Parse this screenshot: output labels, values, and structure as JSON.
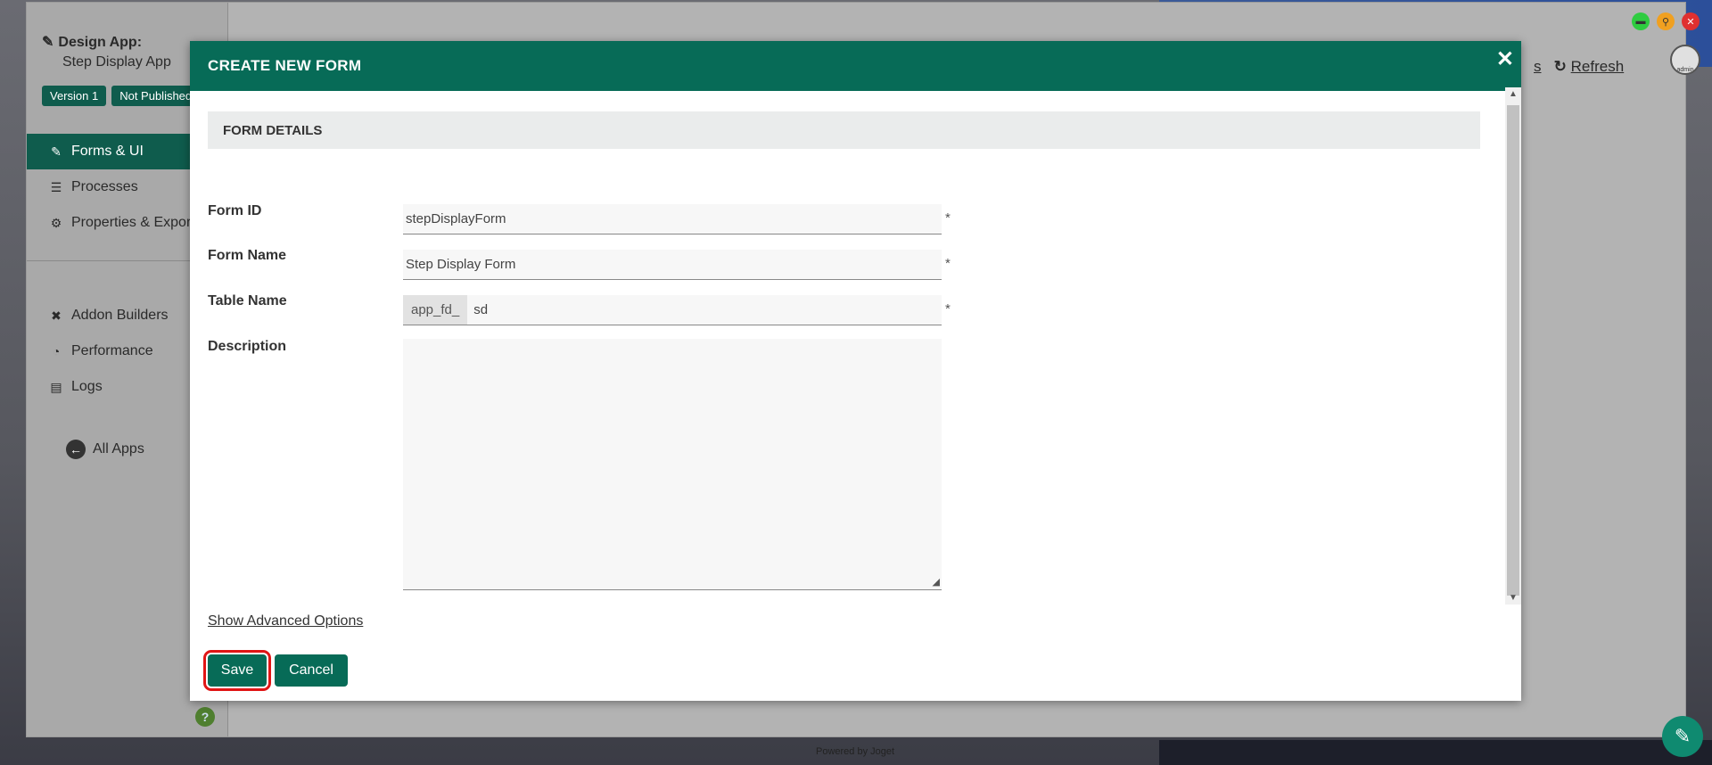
{
  "sidebar": {
    "title": "Design App:",
    "app_name": "Step Display App",
    "badges": [
      "Version 1",
      "Not Published"
    ],
    "nav_primary": [
      {
        "label": "Forms & UI",
        "icon": "edit-icon",
        "active": true
      },
      {
        "label": "Processes",
        "icon": "list-icon",
        "active": false
      },
      {
        "label": "Properties & Export",
        "icon": "gear-icon",
        "active": false
      }
    ],
    "nav_secondary": [
      {
        "label": "Addon Builders",
        "icon": "tools-icon"
      },
      {
        "label": "Performance",
        "icon": "dashboard-icon"
      },
      {
        "label": "Logs",
        "icon": "scroll-icon"
      }
    ],
    "all_apps": "All Apps"
  },
  "header_links": {
    "partial": "s",
    "refresh": "Refresh"
  },
  "avatar_label": "admin",
  "footer": {
    "powered": "Powered by Joget"
  },
  "dialog": {
    "title": "CREATE NEW FORM",
    "section": "FORM DETAILS",
    "fields": {
      "form_id": {
        "label": "Form ID",
        "value": "stepDisplayForm",
        "required": "*"
      },
      "form_name": {
        "label": "Form Name",
        "value": "Step Display Form",
        "required": "*"
      },
      "table_name": {
        "label": "Table Name",
        "prefix": "app_fd_",
        "value": "sd",
        "required": "*"
      },
      "description": {
        "label": "Description",
        "value": ""
      }
    },
    "advanced_link": "Show Advanced Options",
    "save": "Save",
    "cancel": "Cancel"
  },
  "colors": {
    "primary": "#076b57",
    "highlight": "#e01515"
  }
}
